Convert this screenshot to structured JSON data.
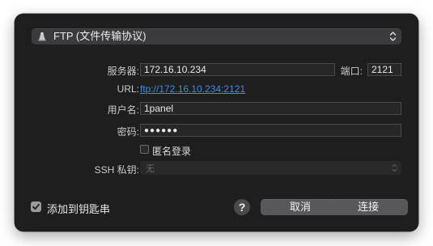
{
  "protocol": {
    "selected": "FTP (文件传输协议)",
    "icon": "ftp-server-icon"
  },
  "form": {
    "server_label": "服务器:",
    "server_value": "172.16.10.234",
    "port_label": "端口:",
    "port_value": "2121",
    "url_label": "URL:",
    "url_value": "ftp://172.16.10.234:2121",
    "username_label": "用户名:",
    "username_value": "1panel",
    "password_label": "密码:",
    "password_value": "●●●●●●",
    "anonymous_label": "匿名登录",
    "anonymous_checked": false,
    "ssh_key_label": "SSH 私钥:",
    "ssh_key_value": "无"
  },
  "footer": {
    "keychain_label": "添加到钥匙串",
    "keychain_checked": true,
    "help_label": "?",
    "cancel_label": "取消",
    "connect_label": "连接"
  },
  "colors": {
    "dialog_bg": "#1e1e1f",
    "link": "#3b8cf2",
    "button_bg": "#58585a"
  }
}
